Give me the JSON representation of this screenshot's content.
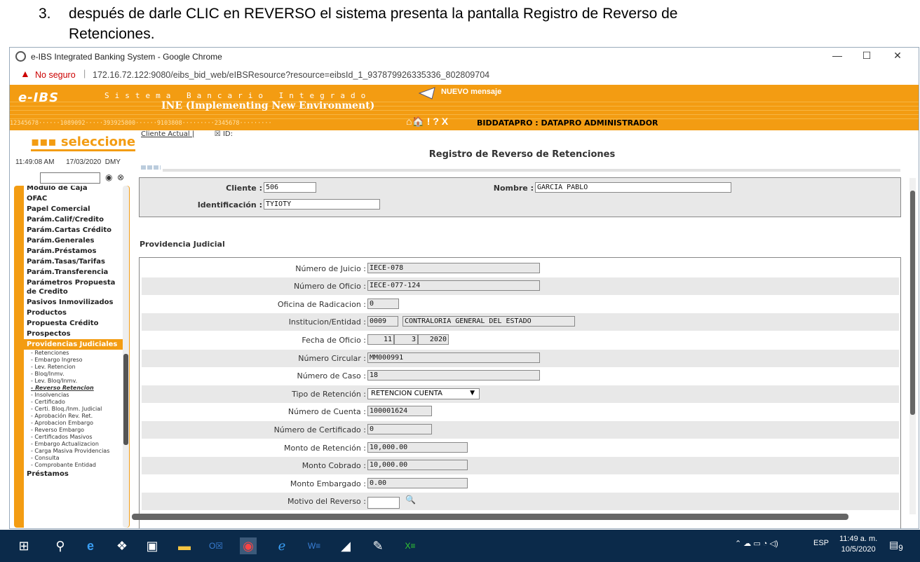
{
  "doc": {
    "number": "3.",
    "line1": "después de darle CLIC en REVERSO el sistema presenta la pantalla Registro de Reverso de",
    "line2": "Retenciones."
  },
  "browser": {
    "title": "e-IBS Integrated Banking System - Google Chrome",
    "not_secure": "No seguro",
    "url": "172.16.72.122:9080/eibs_bid_web/eIBSResource?resource=eibsId_1_937879926335336_802809704",
    "minimize": "—",
    "maximize": "☐",
    "close": "✕"
  },
  "header": {
    "logo": "e-IBS",
    "sistema": "Sistema Bancario Integrado",
    "ine": "INE (Implementing New Environment)",
    "nuevo_mensaje": "NUEVO mensaje",
    "num_strip": "12345678······1089092·····393925800······9103808·········2345678·········",
    "tools": "⌂🏠 ! ? X",
    "user": "BIDDATAPRO : DATAPRO ADMINISTRADOR"
  },
  "sidebar": {
    "seleccione": "seleccione",
    "time": "11:49:08 AM",
    "date": "17/03/2020",
    "date_format": "DMY",
    "items": [
      {
        "label": "Modulo de Caja",
        "type": "item"
      },
      {
        "label": "OFAC",
        "type": "item"
      },
      {
        "label": "Papel Comercial",
        "type": "item"
      },
      {
        "label": "Parám.Calif/Credito",
        "type": "item"
      },
      {
        "label": "Parám.Cartas Crédito",
        "type": "item"
      },
      {
        "label": "Parám.Generales",
        "type": "item"
      },
      {
        "label": "Parám.Préstamos",
        "type": "item"
      },
      {
        "label": "Parám.Tasas/Tarifas",
        "type": "item"
      },
      {
        "label": "Parám.Transferencia",
        "type": "item"
      },
      {
        "label": "Parámetros Propuesta de Credito",
        "type": "item"
      },
      {
        "label": "Pasivos Inmovilizados",
        "type": "item"
      },
      {
        "label": "Productos",
        "type": "item"
      },
      {
        "label": "Propuesta Crédito",
        "type": "item"
      },
      {
        "label": "Prospectos",
        "type": "item"
      },
      {
        "label": "Providencias Judiciales",
        "type": "sel"
      },
      {
        "label": "- Retenciones",
        "type": "sub"
      },
      {
        "label": "- Embargo Ingreso",
        "type": "sub"
      },
      {
        "label": "- Lev. Retencion",
        "type": "sub"
      },
      {
        "label": "- Bloq/Inmv.",
        "type": "sub"
      },
      {
        "label": "- Lev. Bloq/Inmv.",
        "type": "sub"
      },
      {
        "label": "- Reverso Retencion",
        "type": "act"
      },
      {
        "label": "- Insolvencias",
        "type": "sub"
      },
      {
        "label": "- Certificado",
        "type": "sub"
      },
      {
        "label": "- Certi. Bloq./Inm. Judicial",
        "type": "sub"
      },
      {
        "label": "- Aprobación Rev. Ret.",
        "type": "sub"
      },
      {
        "label": "- Aprobacion Embargo",
        "type": "sub"
      },
      {
        "label": "- Reverso Embargo",
        "type": "sub"
      },
      {
        "label": "- Certificados Masivos",
        "type": "sub"
      },
      {
        "label": "- Embargo Actualizacion",
        "type": "sub"
      },
      {
        "label": "- Carga Masiva Providencias",
        "type": "sub"
      },
      {
        "label": "- Consulta",
        "type": "sub"
      },
      {
        "label": "- Comprobante Entidad",
        "type": "sub"
      },
      {
        "label": "Préstamos",
        "type": "item"
      }
    ]
  },
  "main": {
    "cliente_actual": "Cliente Actual |",
    "id_label": "ID:",
    "title": "Registro de Reverso de Retenciones",
    "cliente_label": "Cliente :",
    "cliente_value": "506",
    "nombre_label": "Nombre :",
    "nombre_value": "GARCIA PABLO",
    "ident_label": "Identificación :",
    "ident_value": "TYIOTY",
    "section": "Providencia Judicial",
    "numero_juicio_label": "Número de Juicio :",
    "numero_juicio": "IECE-078",
    "numero_oficio_label": "Número de Oficio :",
    "numero_oficio": "IECE-077-124",
    "oficina_label": "Oficina de Radicacion :",
    "oficina": "0",
    "institucion_label": "Institucion/Entidad :",
    "institucion_code": "0009",
    "institucion_name": "CONTRALORIA GENERAL DEL ESTADO",
    "fecha_label": "Fecha de Oficio :",
    "fecha_d": "11",
    "fecha_m": "3",
    "fecha_y": "2020",
    "circular_label": "Número Circular :",
    "circular": "MM000991",
    "caso_label": "Número de Caso :",
    "caso": "18",
    "tipo_label": "Tipo de Retención :",
    "tipo": "RETENCION CUENTA",
    "cuenta_label": "Número de Cuenta :",
    "cuenta": "100001624",
    "certificado_label": "Número de Certificado :",
    "certificado": "0",
    "monto_ret_label": "Monto de Retención :",
    "monto_ret": "10,000.00",
    "monto_cob_label": "Monto Cobrado :",
    "monto_cob": "10,000.00",
    "monto_emb_label": "Monto Embargado :",
    "monto_emb": "0.00",
    "motivo_label": "Motivo del Reverso :"
  },
  "taskbar": {
    "lang": "ESP",
    "time": "11:49 a. m.",
    "date": "10/5/2020",
    "notif": "9"
  },
  "colors": {
    "accent": "#f39c12",
    "taskbar": "#0b2a4a"
  }
}
